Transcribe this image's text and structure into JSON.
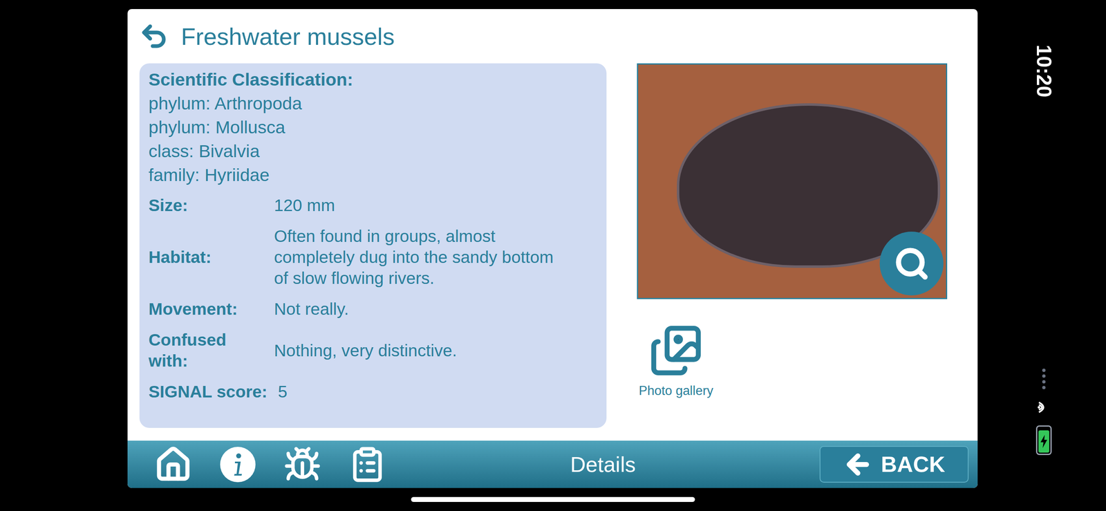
{
  "header": {
    "title": "Freshwater mussels"
  },
  "classification": {
    "heading": "Scientific Classification:",
    "rows": [
      {
        "label": "phylum:",
        "value": "Arthropoda"
      },
      {
        "label": "phylum:",
        "value": "Mollusca"
      },
      {
        "label": "class:",
        "value": "Bivalvia"
      },
      {
        "label": "family:",
        "value": "Hyriidae"
      }
    ]
  },
  "details": [
    {
      "label": "Size:",
      "value": "120 mm"
    },
    {
      "label": "Habitat:",
      "value": "Often found in groups, almost completely dug into the sandy bottom of slow flowing rivers."
    },
    {
      "label": "Movement:",
      "value": "Not really."
    },
    {
      "label": "Confused with:",
      "value": "Nothing, very distinctive."
    }
  ],
  "signal": {
    "label": "SIGNAL score:",
    "value": "5"
  },
  "gallery": {
    "label": "Photo gallery"
  },
  "bottom_bar": {
    "title": "Details",
    "back": "BACK"
  },
  "status_bar": {
    "time": "10:20",
    "battery": {
      "level": 0.9,
      "charging": true
    }
  }
}
